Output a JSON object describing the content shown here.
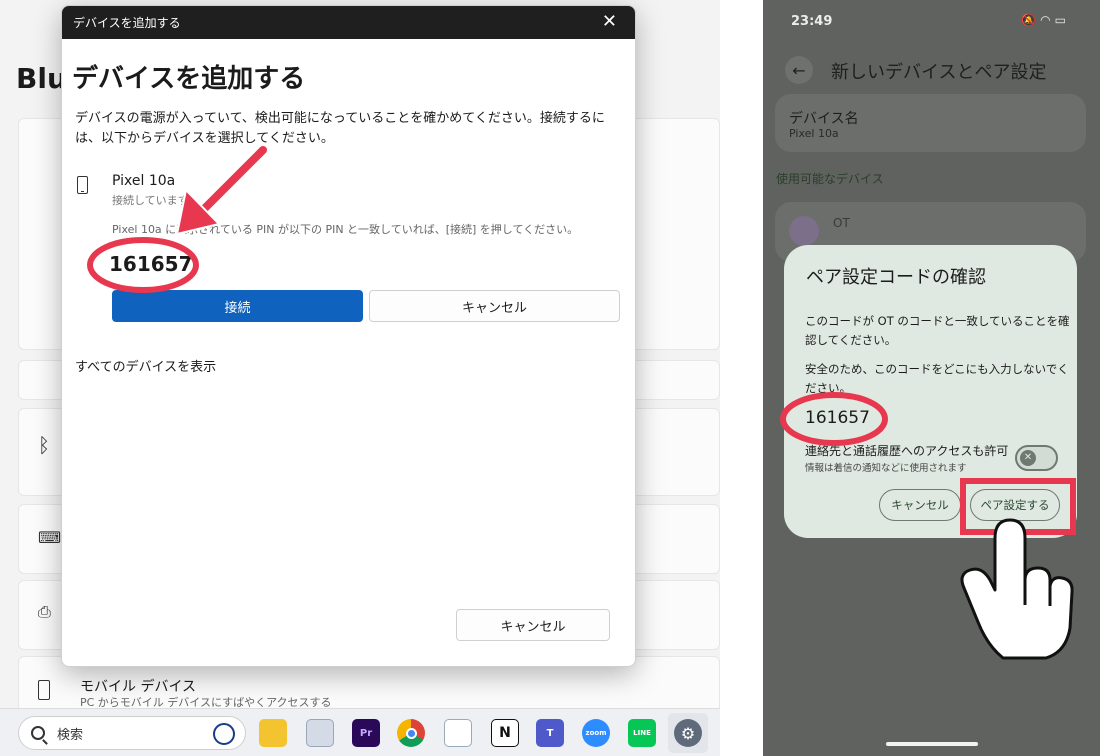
{
  "windows": {
    "background": {
      "page_title": "Blue",
      "mobile_title": "モバイル デバイス",
      "mobile_subtitle": "PC からモバイル デバイスにすばやくアクセスする"
    },
    "dialog": {
      "window_title": "デバイスを追加する",
      "heading": "デバイスを追加する",
      "description": "デバイスの電源が入っていて、検出可能になっていることを確かめてください。接続するには、以下からデバイスを選択してください。",
      "device_name": "Pixel 10a",
      "device_status": "接続しています...",
      "pin_note": "Pixel 10a に表示されている PIN が以下の PIN と一致していれば、[接続] を押してください。",
      "pin": "161657",
      "connect_label": "接続",
      "cancel_label": "キャンセル",
      "show_all_label": "すべてのデバイスを表示",
      "bottom_cancel_label": "キャンセル"
    },
    "taskbar": {
      "search_placeholder": "検索",
      "apps": [
        "file-explorer",
        "snipping-tool",
        "premiere-pro",
        "chrome",
        "paint",
        "notion",
        "teams",
        "zoom",
        "line",
        "settings"
      ]
    },
    "colors": {
      "accent": "#0f62be",
      "annotation": "#e8384f"
    }
  },
  "android": {
    "status_time": "23:49",
    "status_icons": [
      "mute-icon",
      "wifi-icon",
      "battery-icon"
    ],
    "page_title": "新しいデバイスとペア設定",
    "device_name_label": "デバイス名",
    "device_name_value": "Pixel 10a",
    "section_label": "使用可能なデバイス",
    "available_device": "OT",
    "dialog": {
      "title": "ペア設定コードの確認",
      "text1": "このコードが OT のコードと一致していることを確認してください。",
      "text2": "安全のため、このコードをどこにも入力しないでください。",
      "code": "161657",
      "permission_label": "連絡先と通話履歴へのアクセスも許可",
      "permission_sub": "情報は着信の通知などに使用されます",
      "cancel_label": "キャンセル",
      "pair_label": "ペア設定する"
    }
  }
}
